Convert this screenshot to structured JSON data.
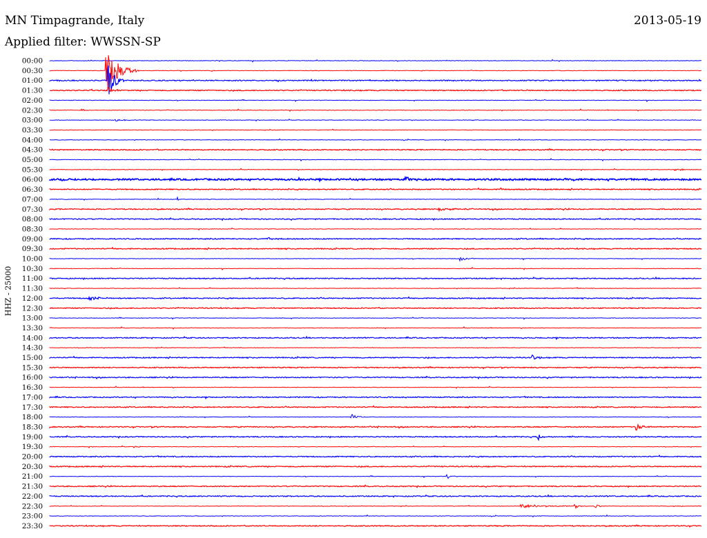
{
  "header": {
    "station": "MN Timpagrande, Italy",
    "date": "2013-05-19",
    "filter": "Applied filter: WWSSN-SP"
  },
  "chart_data": {
    "type": "line",
    "ylabel": "HHZ - 25000",
    "colors": {
      "even": "#0000ff",
      "odd": "#ff0000"
    },
    "row_labels": [
      "00:00",
      "00:30",
      "01:00",
      "01:30",
      "02:00",
      "02:30",
      "03:00",
      "03:30",
      "04:00",
      "04:30",
      "05:00",
      "05:30",
      "06:00",
      "06:30",
      "07:00",
      "07:30",
      "08:00",
      "08:30",
      "09:00",
      "09:30",
      "10:00",
      "10:30",
      "11:00",
      "11:30",
      "12:00",
      "12:30",
      "13:00",
      "13:30",
      "14:00",
      "14:30",
      "15:00",
      "15:30",
      "16:00",
      "16:30",
      "17:00",
      "17:30",
      "18:00",
      "18:30",
      "19:00",
      "19:30",
      "20:00",
      "20:30",
      "21:00",
      "21:30",
      "22:00",
      "22:30",
      "23:00",
      "23:30"
    ],
    "noise_levels": [
      1,
      1,
      2,
      2,
      1,
      1,
      1,
      1,
      1,
      2,
      1,
      1,
      3,
      2,
      1,
      2,
      2,
      1,
      2,
      2,
      1,
      1,
      2,
      1,
      2,
      2,
      1,
      1,
      2,
      1,
      2,
      2,
      2,
      1,
      2,
      2,
      1,
      2,
      2,
      1,
      2,
      2,
      1,
      2,
      2,
      1,
      1,
      2
    ],
    "events": [
      {
        "row": 1,
        "minute": 2.6,
        "width": 1.5,
        "amp": 30
      },
      {
        "row": 2,
        "minute": 2.7,
        "width": 0.8,
        "amp": 24
      },
      {
        "row": 3,
        "minute": 2.7,
        "width": 0.5,
        "amp": 4
      },
      {
        "row": 5,
        "minute": 1.5,
        "width": 0.5,
        "amp": 2
      },
      {
        "row": 6,
        "minute": 3.0,
        "width": 1.1,
        "amp": 2
      },
      {
        "row": 12,
        "minute": 16.4,
        "width": 0.4,
        "amp": 6
      },
      {
        "row": 13,
        "minute": 20.8,
        "width": 0.2,
        "amp": 3
      },
      {
        "row": 14,
        "minute": 5.9,
        "width": 0.2,
        "amp": 3
      },
      {
        "row": 15,
        "minute": 17.9,
        "width": 1.4,
        "amp": 2
      },
      {
        "row": 11,
        "minute": 28.8,
        "width": 1.0,
        "amp": 2
      },
      {
        "row": 18,
        "minute": 10.0,
        "width": 0.8,
        "amp": 3
      },
      {
        "row": 20,
        "minute": 18.9,
        "width": 0.7,
        "amp": 3
      },
      {
        "row": 24,
        "minute": 1.8,
        "width": 1.5,
        "amp": 3
      },
      {
        "row": 30,
        "minute": 22.2,
        "width": 0.6,
        "amp": 5
      },
      {
        "row": 33,
        "minute": 28.4,
        "width": 0.3,
        "amp": 2
      },
      {
        "row": 36,
        "minute": 13.9,
        "width": 0.6,
        "amp": 5
      },
      {
        "row": 37,
        "minute": 27.0,
        "width": 0.8,
        "amp": 5
      },
      {
        "row": 38,
        "minute": 22.5,
        "width": 0.5,
        "amp": 4
      },
      {
        "row": 39,
        "minute": 3.9,
        "width": 0.6,
        "amp": 2
      },
      {
        "row": 42,
        "minute": 18.3,
        "width": 0.6,
        "amp": 3
      },
      {
        "row": 45,
        "minute": 21.7,
        "width": 3.3,
        "amp": 3
      },
      {
        "row": 45,
        "minute": 24.2,
        "width": 0.5,
        "amp": 3
      },
      {
        "row": 45,
        "minute": 25.1,
        "width": 0.5,
        "amp": 3
      }
    ]
  }
}
